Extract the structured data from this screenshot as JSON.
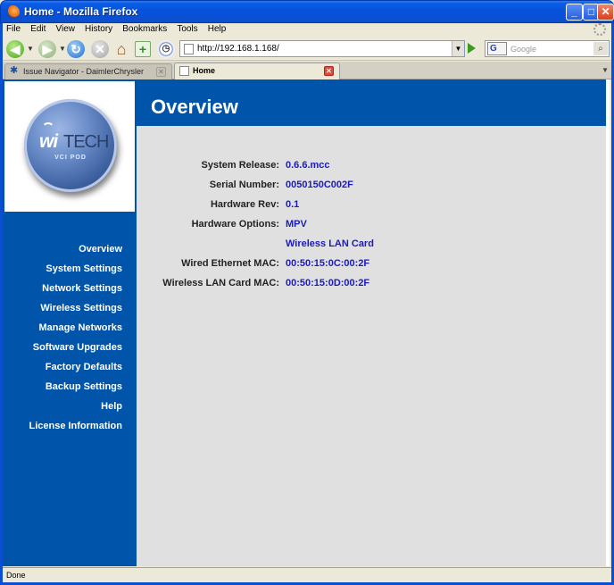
{
  "window": {
    "title": "Home - Mozilla Firefox",
    "minimize": "_",
    "maximize": "□",
    "close": "✕"
  },
  "menu": {
    "items": [
      {
        "label": "File"
      },
      {
        "label": "Edit"
      },
      {
        "label": "View"
      },
      {
        "label": "History"
      },
      {
        "label": "Bookmarks"
      },
      {
        "label": "Tools"
      },
      {
        "label": "Help"
      }
    ]
  },
  "toolbar": {
    "url": "http://192.168.1.168/",
    "search_placeholder": "Google",
    "search_engine": "G"
  },
  "tabs": [
    {
      "label": "Issue Navigator - DaimlerChrysler",
      "active": false
    },
    {
      "label": "Home",
      "active": true
    }
  ],
  "logo": {
    "brand_wi": "wi",
    "brand_tech": "TECH",
    "subtitle": "VCI POD"
  },
  "sidebar": {
    "items": [
      {
        "label": "Overview"
      },
      {
        "label": "System Settings"
      },
      {
        "label": "Network Settings"
      },
      {
        "label": "Wireless Settings"
      },
      {
        "label": "Manage Networks"
      },
      {
        "label": "Software Upgrades"
      },
      {
        "label": "Factory Defaults"
      },
      {
        "label": "Backup Settings"
      },
      {
        "label": "Help"
      },
      {
        "label": "License Information"
      }
    ]
  },
  "page": {
    "title": "Overview"
  },
  "info": {
    "rows": [
      {
        "label": "System Release:",
        "value": "0.6.6.mcc"
      },
      {
        "label": "Serial Number:",
        "value": "0050150C002F"
      },
      {
        "label": "Hardware Rev:",
        "value": "0.1"
      },
      {
        "label": "Hardware Options:",
        "value": "MPV"
      },
      {
        "label": "",
        "value": "Wireless LAN Card"
      },
      {
        "label": "Wired Ethernet MAC:",
        "value": "00:50:15:0C:00:2F"
      },
      {
        "label": "Wireless LAN Card MAC:",
        "value": "00:50:15:0D:00:2F"
      }
    ]
  },
  "status": {
    "text": "Done"
  },
  "colors": {
    "brand_blue": "#0055aa",
    "value_blue": "#1a1ac0",
    "content_gray": "#e0e0e0"
  }
}
